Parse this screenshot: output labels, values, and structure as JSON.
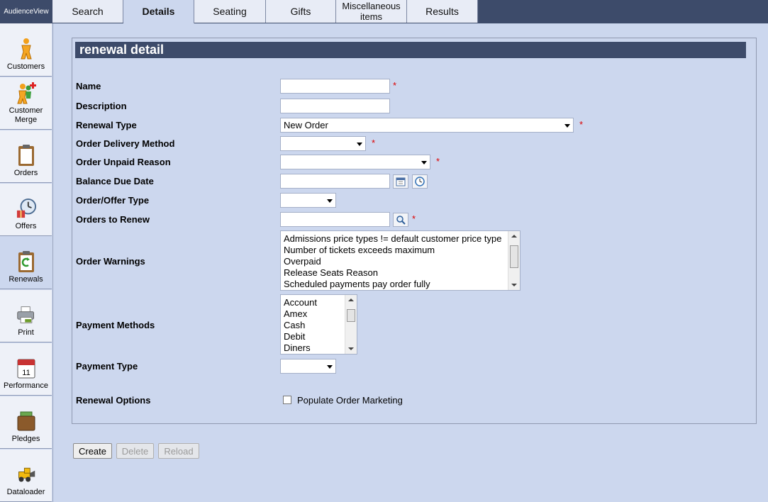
{
  "app": {
    "brand": "AudienceView"
  },
  "tabs": [
    {
      "label": "Search"
    },
    {
      "label": "Details"
    },
    {
      "label": "Seating"
    },
    {
      "label": "Gifts"
    },
    {
      "label": "Miscellaneous items"
    },
    {
      "label": "Results"
    }
  ],
  "sidebar": {
    "items": [
      {
        "label": "Customers",
        "icon": "customer-icon"
      },
      {
        "label": "Customer Merge",
        "icon": "customer-merge-icon"
      },
      {
        "label": "Orders",
        "icon": "clipboard-icon"
      },
      {
        "label": "Offers",
        "icon": "clock-gift-icon"
      },
      {
        "label": "Renewals",
        "icon": "renewal-icon"
      },
      {
        "label": "Print",
        "icon": "printer-icon"
      },
      {
        "label": "Performance",
        "icon": "calendar-icon"
      },
      {
        "label": "Pledges",
        "icon": "wallet-icon"
      },
      {
        "label": "Dataloader",
        "icon": "loader-icon"
      }
    ]
  },
  "form": {
    "title": "renewal detail",
    "name_label": "Name",
    "name_value": "",
    "description_label": "Description",
    "description_value": "",
    "renewal_type_label": "Renewal Type",
    "renewal_type_value": "New Order",
    "delivery_label": "Order Delivery Method",
    "delivery_value": "",
    "unpaid_label": "Order Unpaid Reason",
    "unpaid_value": "",
    "balance_label": "Balance Due Date",
    "balance_value": "",
    "offer_type_label": "Order/Offer Type",
    "offer_type_value": "",
    "orders_label": "Orders to Renew",
    "orders_value": "",
    "warnings_label": "Order Warnings",
    "warnings_options": [
      "Admissions price types != default customer price type",
      "Number of tickets exceeds maximum",
      "Overpaid",
      "Release Seats Reason",
      "Scheduled payments pay order fully"
    ],
    "payment_methods_label": "Payment Methods",
    "payment_methods_options": [
      "Account",
      "Amex",
      "Cash",
      "Debit",
      "Diners"
    ],
    "payment_type_label": "Payment Type",
    "payment_type_value": "",
    "options_label": "Renewal Options",
    "populate_label": "Populate Order Marketing",
    "populate_checked": false,
    "required_mark": "*"
  },
  "buttons": {
    "create": "Create",
    "delete": "Delete",
    "reload": "Reload"
  }
}
